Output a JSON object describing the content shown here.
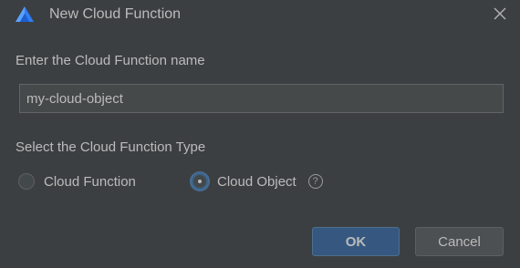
{
  "window": {
    "title": "New Cloud Function",
    "app_icon": "app-logo-icon",
    "close_icon": "close-icon"
  },
  "form": {
    "name_label": "Enter the Cloud Function name",
    "name_value": "my-cloud-object",
    "type_label": "Select the Cloud Function Type",
    "types": [
      {
        "label": "Cloud Function",
        "selected": false
      },
      {
        "label": "Cloud Object",
        "selected": true
      }
    ],
    "help_icon_glyph": "?"
  },
  "buttons": {
    "ok_label": "OK",
    "cancel_label": "Cancel"
  },
  "colors": {
    "background": "#3c3f41",
    "accent": "#365880",
    "text": "#bbbbbb"
  }
}
